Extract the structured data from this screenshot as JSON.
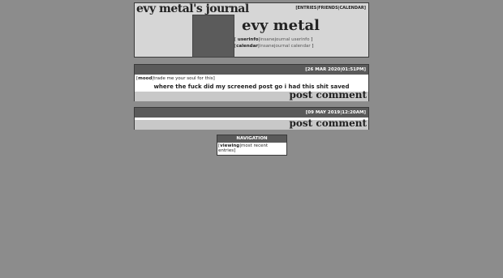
{
  "header": {
    "journal_title": "evy metal's journal",
    "top_links": "[ENTRIES|FRIENDS|CALENDAR]",
    "user_name": "evy metal",
    "userinfo_label": "userinfo",
    "userinfo_link": "insanejournal userinfo",
    "calendar_label": "calendar",
    "calendar_link": "insanejournal calendar"
  },
  "entries": [
    {
      "date": "[26 MAR 2020|01:51PM]",
      "mood_label": "mood",
      "mood_value": "trade me your soul for this",
      "text": "where the fuck did my screened post go i had this shit saved",
      "post_comment": "post comment"
    },
    {
      "date": "[09 MAY 2019|12:20AM]",
      "post_comment": "post comment"
    }
  ],
  "navigation": {
    "title": "NAVIGATION",
    "viewing_label": "viewing",
    "viewing_value": "most recent entries"
  }
}
